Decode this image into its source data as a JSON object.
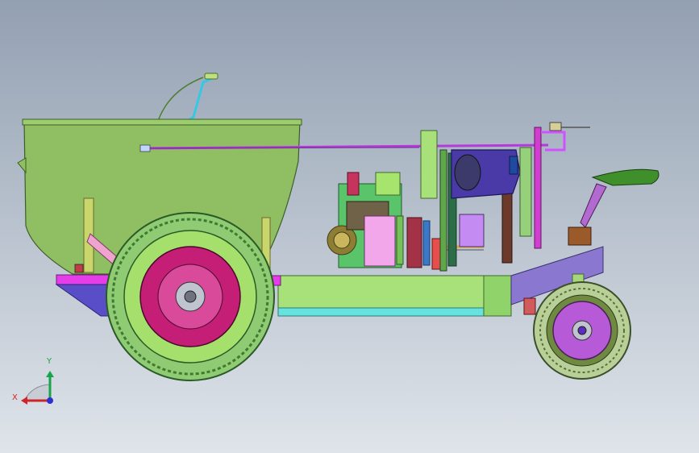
{
  "view": {
    "triad": {
      "x_label": "X",
      "y_label": "Y"
    },
    "colors": {
      "background_top": "#93a0b2",
      "background_bottom": "#dfe4ea",
      "hopper": "#8fbf62",
      "frame": "#a8e07a",
      "frame_rail": "#66e2df",
      "magenta_part": "#e53ee8",
      "rear_tire": "#8ecb72",
      "front_tire": "#b9cf98",
      "hub": "#c41e76",
      "motor_housing": "#4a3aa8",
      "seat": "#3f8f2a",
      "engine_box": "#f1a7ea",
      "axis_x": "#d0232a",
      "axis_y": "#19a44b",
      "axis_z": "#2d2fd1"
    },
    "icons": [
      "coordinate-triad-icon"
    ]
  }
}
